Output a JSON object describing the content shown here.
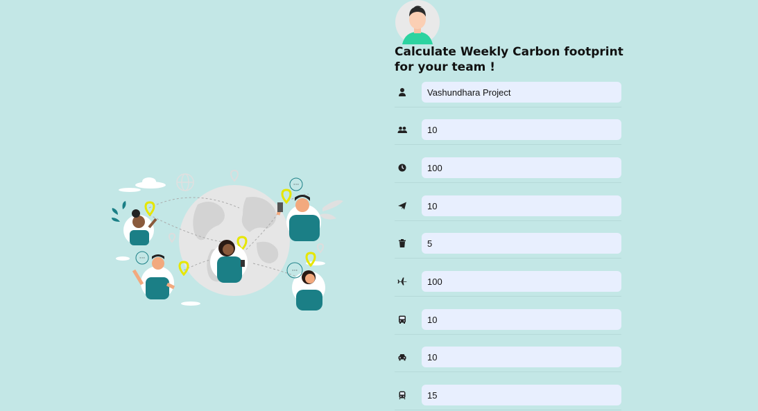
{
  "form": {
    "title": "Calculate Weekly Carbon footprint for your team !",
    "fields": [
      {
        "icon": "user-icon",
        "value": "Vashundhara Project"
      },
      {
        "icon": "users-icon",
        "value": "10"
      },
      {
        "icon": "clock-icon",
        "value": "100"
      },
      {
        "icon": "paper-plane-icon",
        "value": "10"
      },
      {
        "icon": "trash-icon",
        "value": "5"
      },
      {
        "icon": "plane-icon",
        "value": "100"
      },
      {
        "icon": "bus-icon",
        "value": "10"
      },
      {
        "icon": "car-icon",
        "value": "10"
      },
      {
        "icon": "train-icon",
        "value": "15"
      }
    ]
  },
  "colors": {
    "background": "#c3e7e6",
    "input_background": "#e8effe",
    "accent_teal": "#1b7f86",
    "pin_yellow": "#e6e600"
  }
}
